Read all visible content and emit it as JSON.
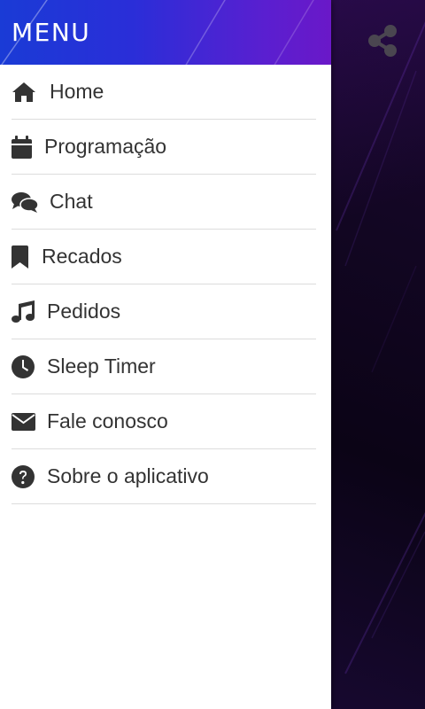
{
  "drawer": {
    "title": "MENU",
    "items": [
      {
        "label": "Home",
        "icon": "home-icon"
      },
      {
        "label": "Programação",
        "icon": "calendar-icon"
      },
      {
        "label": "Chat",
        "icon": "chat-bubbles-icon"
      },
      {
        "label": "Recados",
        "icon": "bookmark-icon"
      },
      {
        "label": "Pedidos",
        "icon": "music-note-icon"
      },
      {
        "label": "Sleep Timer",
        "icon": "clock-icon"
      },
      {
        "label": "Fale conosco",
        "icon": "envelope-icon"
      },
      {
        "label": "Sobre o aplicativo",
        "icon": "question-circle-icon"
      }
    ]
  },
  "app": {
    "share_icon": "share-icon"
  },
  "colors": {
    "header_gradient_start": "#1a3bd6",
    "header_gradient_end": "#6a18c8",
    "menu_text": "#333333",
    "divider": "#dcdcdc",
    "background_dark": "#120a22"
  }
}
